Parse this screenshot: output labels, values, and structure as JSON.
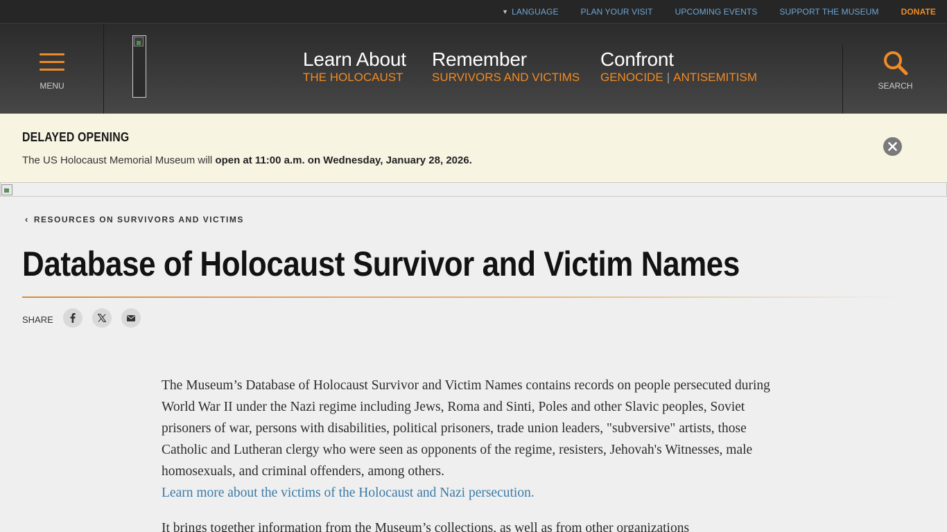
{
  "utility_nav": {
    "language": "LANGUAGE",
    "plan_visit": "PLAN YOUR VISIT",
    "upcoming_events": "UPCOMING EVENTS",
    "support": "SUPPORT THE MUSEUM",
    "donate": "DONATE"
  },
  "header": {
    "menu_label": "MENU",
    "search_label": "SEARCH",
    "nav": [
      {
        "big": "Learn About",
        "small": "THE HOLOCAUST"
      },
      {
        "big": "Remember",
        "small": "SURVIVORS AND VICTIMS"
      },
      {
        "big": "Confront",
        "small_a": "GENOCIDE",
        "small_sep": "|",
        "small_b": "ANTISEMITISM"
      }
    ]
  },
  "alert": {
    "title": "DELAYED OPENING",
    "message_prefix": "The US Holocaust Memorial Museum will ",
    "message_bold": "open at 11:00 a.m. on Wednesday, January 28, 2026."
  },
  "breadcrumb": "RESOURCES ON SURVIVORS AND VICTIMS",
  "page_title": "Database of Holocaust Survivor and Victim Names",
  "share": {
    "label": "SHARE"
  },
  "body": {
    "para1": "The Museum’s Database of Holocaust Survivor and Victim Names contains records on people persecuted during World War II under the Nazi regime including Jews, Roma and Sinti, Poles and other Slavic peoples, Soviet prisoners of war, persons with disabilities, political prisoners, trade union leaders, \"subversive\" artists, those Catholic and Lutheran clergy who were seen as opponents of the regime, resisters, Jehovah's Witnesses, male homosexuals, and criminal offenders, among others.",
    "para1_link": "Learn more about the victims of the Holocaust and Nazi persecution.",
    "para2": "It brings together information from the Museum’s collections, as well as from other organizations"
  },
  "colors": {
    "accent_orange": "#f08b25",
    "link_blue": "#3a7ba8",
    "header_dark": "#2b2b2b",
    "alert_bg": "#f7f4e2"
  }
}
